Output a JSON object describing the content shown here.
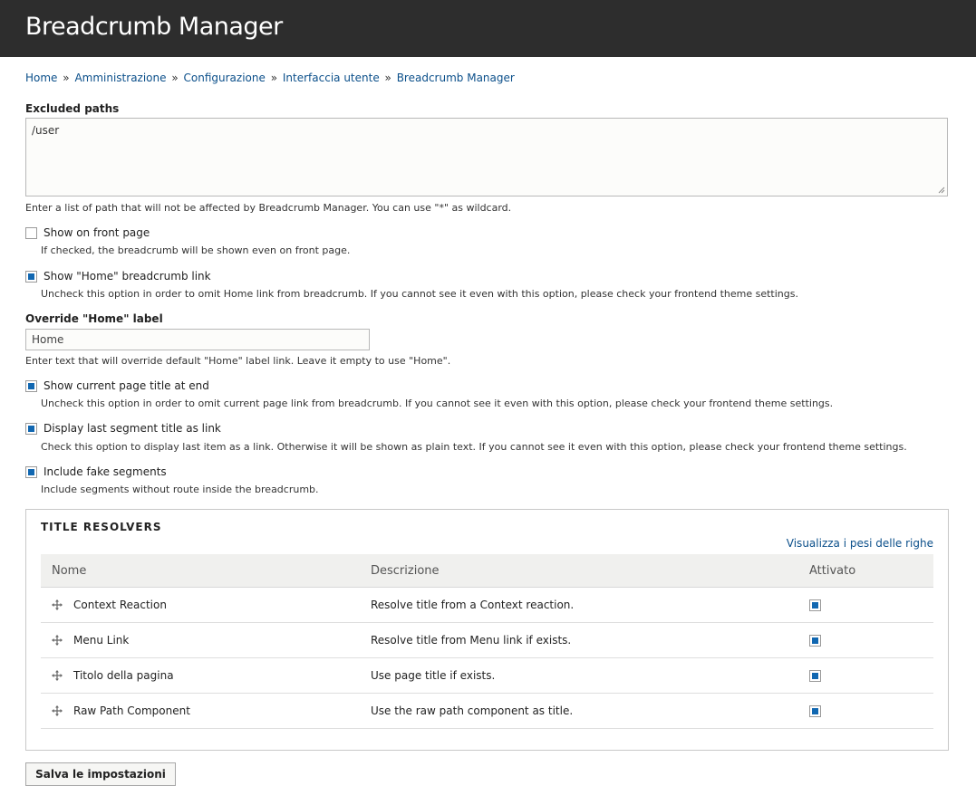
{
  "header": {
    "title": "Breadcrumb Manager"
  },
  "breadcrumb": {
    "items": [
      "Home",
      "Amministrazione",
      "Configurazione",
      "Interfaccia utente",
      "Breadcrumb Manager"
    ],
    "separator": "»"
  },
  "excluded_paths": {
    "label": "Excluded paths",
    "value": "/user",
    "description": "Enter a list of path that will not be affected by Breadcrumb Manager. You can use \"*\" as wildcard."
  },
  "options": [
    {
      "label": "Show on front page",
      "checked": false,
      "description": "If checked, the breadcrumb will be shown even on front page."
    },
    {
      "label": "Show \"Home\" breadcrumb link",
      "checked": true,
      "description": "Uncheck this option in order to omit Home link from breadcrumb. If you cannot see it even with this option, please check your frontend theme settings."
    },
    {
      "label": "Show current page title at end",
      "checked": true,
      "description": "Uncheck this option in order to omit current page link from breadcrumb. If you cannot see it even with this option, please check your frontend theme settings."
    },
    {
      "label": "Display last segment title as link",
      "checked": true,
      "description": "Check this option to display last item as a link. Otherwise it will be shown as plain text. If you cannot see it even with this option, please check your frontend theme settings."
    },
    {
      "label": "Include fake segments",
      "checked": true,
      "description": "Include segments without route inside the breadcrumb."
    }
  ],
  "override_home": {
    "label": "Override \"Home\" label",
    "value": "Home",
    "description": "Enter text that will override default \"Home\" label link. Leave it empty to use \"Home\"."
  },
  "title_resolvers": {
    "legend": "TITLE RESOLVERS",
    "weights_link": "Visualizza i pesi delle righe",
    "columns": [
      "Nome",
      "Descrizione",
      "Attivato"
    ],
    "rows": [
      {
        "name": "Context Reaction",
        "description": "Resolve title from a Context reaction.",
        "enabled": true
      },
      {
        "name": "Menu Link",
        "description": "Resolve title from Menu link if exists.",
        "enabled": true
      },
      {
        "name": "Titolo della pagina",
        "description": "Use page title if exists.",
        "enabled": true
      },
      {
        "name": "Raw Path Component",
        "description": "Use the raw path component as title.",
        "enabled": true
      }
    ]
  },
  "actions": {
    "save_label": "Salva le impostazioni"
  },
  "colors": {
    "header_bg": "#2d2d2d",
    "link": "#0b4f8a",
    "checkbox_fill": "#1167b1"
  }
}
